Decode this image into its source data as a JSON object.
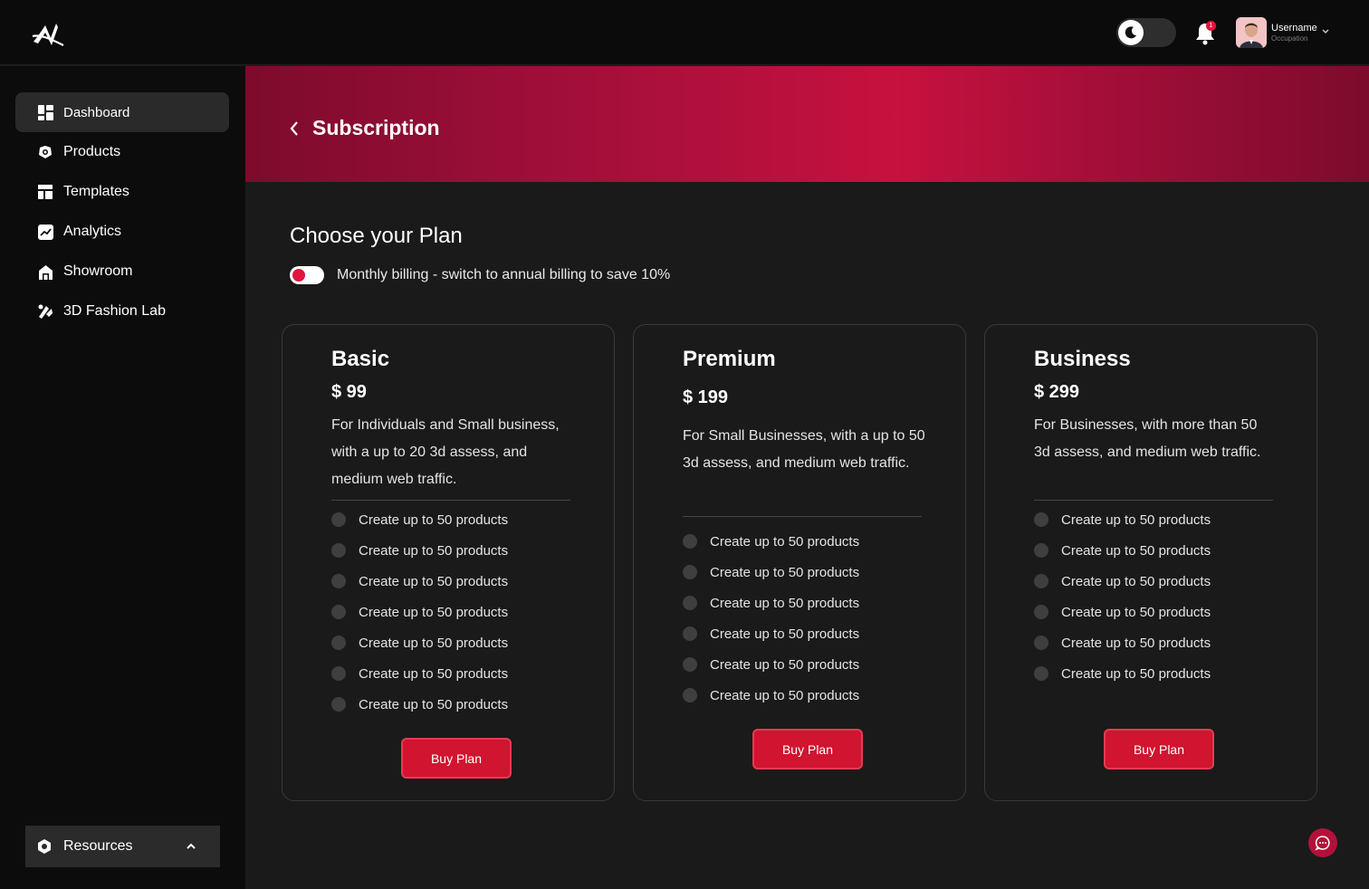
{
  "header": {
    "username": "Username",
    "occupation": "Occupation",
    "notification_count": "1"
  },
  "sidebar": {
    "items": [
      {
        "label": "Dashboard",
        "icon": "dashboard-icon"
      },
      {
        "label": "Products",
        "icon": "products-icon"
      },
      {
        "label": "Templates",
        "icon": "templates-icon"
      },
      {
        "label": "Analytics",
        "icon": "analytics-icon"
      },
      {
        "label": "Showroom",
        "icon": "showroom-icon"
      },
      {
        "label": "3D Fashion Lab",
        "icon": "fashion-lab-icon"
      }
    ],
    "resources_label": "Resources"
  },
  "banner": {
    "title": "Subscription"
  },
  "main": {
    "choose_title": "Choose your Plan",
    "billing_text": "Monthly billing - switch to annual billing to save 10%"
  },
  "plans": [
    {
      "name": "Basic",
      "price": "$ 99",
      "description": "For Individuals and Small business, with a up to 20 3d assess, and medium web traffic.",
      "features": [
        "Create up to 50 products",
        "Create up to 50 products",
        "Create up to 50 products",
        "Create up to 50 products",
        "Create up to 50 products",
        "Create up to 50 products",
        "Create up to 50 products"
      ],
      "button": "Buy Plan"
    },
    {
      "name": "Premium",
      "price": "$ 199",
      "description": "For Small Businesses, with a up to 50 3d assess, and medium web traffic.",
      "features": [
        "Create up to 50 products",
        "Create up to 50 products",
        "Create up to 50 products",
        "Create up to 50 products",
        "Create up to 50 products",
        "Create up to 50 products"
      ],
      "button": "Buy Plan"
    },
    {
      "name": "Business",
      "price": "$ 299",
      "description": "For Businesses, with more than 50 3d assess, and medium web traffic.",
      "features": [
        "Create up to 50 products",
        "Create up to 50 products",
        "Create up to 50 products",
        "Create up to 50 products",
        "Create up to 50 products",
        "Create up to 50 products"
      ],
      "button": "Buy Plan"
    }
  ],
  "colors": {
    "accent": "#d1142f",
    "banner_mid": "#c7113f",
    "background": "#1a1a1a",
    "sidebar": "#0c0c0c"
  }
}
